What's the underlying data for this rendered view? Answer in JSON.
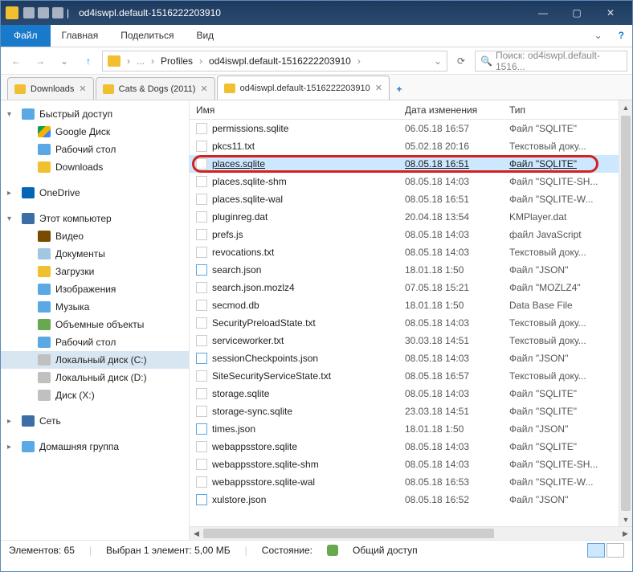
{
  "title": "od4iswpl.default-1516222203910",
  "ribbon": {
    "file": "Файл",
    "home": "Главная",
    "share": "Поделиться",
    "view": "Вид"
  },
  "breadcrumbs": [
    "Profiles",
    "od4iswpl.default-1516222203910"
  ],
  "search_placeholder": "Поиск: od4iswpl.default-1516...",
  "tabs": [
    {
      "label": "Downloads"
    },
    {
      "label": "Cats & Dogs (2011)"
    },
    {
      "label": "od4iswpl.default-1516222203910",
      "active": true
    }
  ],
  "nav": [
    {
      "label": "Быстрый доступ",
      "icon": "star",
      "chev": "▾"
    },
    {
      "label": "Google Диск",
      "icon": "gd",
      "sub": true
    },
    {
      "label": "Рабочий стол",
      "icon": "desk",
      "sub": true
    },
    {
      "label": "Downloads",
      "icon": "dl",
      "sub": true
    },
    {
      "gap": true
    },
    {
      "label": "OneDrive",
      "icon": "od",
      "chev": "▸"
    },
    {
      "gap": true
    },
    {
      "label": "Этот компьютер",
      "icon": "pc",
      "chev": "▾"
    },
    {
      "label": "Видео",
      "icon": "vid",
      "sub": true
    },
    {
      "label": "Документы",
      "icon": "doc",
      "sub": true
    },
    {
      "label": "Загрузки",
      "icon": "dl",
      "sub": true
    },
    {
      "label": "Изображения",
      "icon": "img",
      "sub": true
    },
    {
      "label": "Музыка",
      "icon": "mus",
      "sub": true
    },
    {
      "label": "Объемные объекты",
      "icon": "obj",
      "sub": true
    },
    {
      "label": "Рабочий стол",
      "icon": "desk",
      "sub": true
    },
    {
      "label": "Локальный диск (C:)",
      "icon": "drv",
      "sub": true,
      "sel": true
    },
    {
      "label": "Локальный диск (D:)",
      "icon": "drv",
      "sub": true
    },
    {
      "label": "Диск (X:)",
      "icon": "drv",
      "sub": true
    },
    {
      "gap": true
    },
    {
      "label": "Сеть",
      "icon": "net",
      "chev": "▸"
    },
    {
      "gap": true
    },
    {
      "label": "Домашняя группа",
      "icon": "hg",
      "chev": "▸"
    }
  ],
  "columns": {
    "name": "Имя",
    "date": "Дата изменения",
    "type": "Тип"
  },
  "files": [
    {
      "n": "permissions.sqlite",
      "d": "06.05.18 16:57",
      "t": "Файл \"SQLITE\""
    },
    {
      "n": "pkcs11.txt",
      "d": "05.02.18 20:16",
      "t": "Текстовый доку..."
    },
    {
      "n": "places.sqlite",
      "d": "08.05.18 16:51",
      "t": "Файл \"SQLITE\"",
      "sel": true
    },
    {
      "n": "places.sqlite-shm",
      "d": "08.05.18 14:03",
      "t": "Файл \"SQLITE-SH..."
    },
    {
      "n": "places.sqlite-wal",
      "d": "08.05.18 16:51",
      "t": "Файл \"SQLITE-W..."
    },
    {
      "n": "pluginreg.dat",
      "d": "20.04.18 13:54",
      "t": "KMPlayer.dat"
    },
    {
      "n": "prefs.js",
      "d": "08.05.18 14:03",
      "t": "файл JavaScript"
    },
    {
      "n": "revocations.txt",
      "d": "08.05.18 14:03",
      "t": "Текстовый доку..."
    },
    {
      "n": "search.json",
      "d": "18.01.18 1:50",
      "t": "Файл \"JSON\"",
      "json": true
    },
    {
      "n": "search.json.mozlz4",
      "d": "07.05.18 15:21",
      "t": "Файл \"MOZLZ4\""
    },
    {
      "n": "secmod.db",
      "d": "18.01.18 1:50",
      "t": "Data Base File"
    },
    {
      "n": "SecurityPreloadState.txt",
      "d": "08.05.18 14:03",
      "t": "Текстовый доку..."
    },
    {
      "n": "serviceworker.txt",
      "d": "30.03.18 14:51",
      "t": "Текстовый доку..."
    },
    {
      "n": "sessionCheckpoints.json",
      "d": "08.05.18 14:03",
      "t": "Файл \"JSON\"",
      "json": true
    },
    {
      "n": "SiteSecurityServiceState.txt",
      "d": "08.05.18 16:57",
      "t": "Текстовый доку..."
    },
    {
      "n": "storage.sqlite",
      "d": "08.05.18 14:03",
      "t": "Файл \"SQLITE\""
    },
    {
      "n": "storage-sync.sqlite",
      "d": "23.03.18 14:51",
      "t": "Файл \"SQLITE\""
    },
    {
      "n": "times.json",
      "d": "18.01.18 1:50",
      "t": "Файл \"JSON\"",
      "json": true
    },
    {
      "n": "webappsstore.sqlite",
      "d": "08.05.18 14:03",
      "t": "Файл \"SQLITE\""
    },
    {
      "n": "webappsstore.sqlite-shm",
      "d": "08.05.18 14:03",
      "t": "Файл \"SQLITE-SH..."
    },
    {
      "n": "webappsstore.sqlite-wal",
      "d": "08.05.18 16:53",
      "t": "Файл \"SQLITE-W..."
    },
    {
      "n": "xulstore.json",
      "d": "08.05.18 16:52",
      "t": "Файл \"JSON\"",
      "json": true
    }
  ],
  "status": {
    "items": "Элементов: 65",
    "selected": "Выбран 1 элемент: 5,00 МБ",
    "state": "Состояние:",
    "shared": "Общий доступ"
  }
}
